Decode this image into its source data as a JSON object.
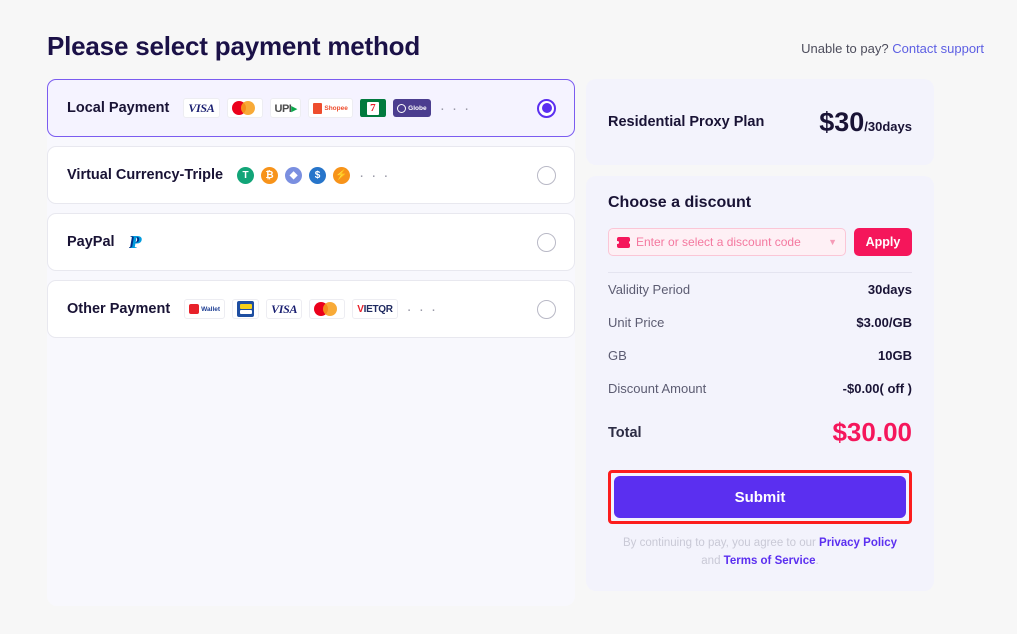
{
  "header": {
    "title": "Please select payment method",
    "support_prefix": "Unable to pay? ",
    "support_link": "Contact support"
  },
  "payment_methods": [
    {
      "name": "Local Payment",
      "selected": true,
      "logos": [
        "visa",
        "mastercard",
        "upi",
        "shopee",
        "seven-eleven",
        "globe"
      ],
      "overflow": "· · ·"
    },
    {
      "name": "Virtual Currency-Triple",
      "selected": false,
      "logos": [
        "tether",
        "bitcoin",
        "ethereum",
        "usdc",
        "lightning"
      ],
      "overflow": "· · ·"
    },
    {
      "name": "PayPal",
      "selected": false,
      "logos": [
        "paypal"
      ],
      "overflow": ""
    },
    {
      "name": "Other Payment",
      "selected": false,
      "logos": [
        "airtel-wallet",
        "touch-n-go",
        "visa",
        "mastercard",
        "vietqr"
      ],
      "overflow": "· · ·"
    }
  ],
  "plan": {
    "name": "Residential Proxy Plan",
    "price_amount": "$30",
    "price_period": "/30days"
  },
  "discount": {
    "title": "Choose a discount",
    "placeholder": "Enter or select a discount code",
    "value": "",
    "apply_label": "Apply"
  },
  "details": [
    {
      "label": "Validity Period",
      "value": "30days"
    },
    {
      "label": "Unit Price",
      "value": "$3.00/GB"
    },
    {
      "label": "GB",
      "value": "10GB"
    },
    {
      "label": "Discount Amount",
      "value": "-$0.00( off )"
    }
  ],
  "total": {
    "label": "Total",
    "value": "$30.00"
  },
  "submit": {
    "label": "Submit",
    "highlighted": true
  },
  "legal": {
    "prefix": "By continuing to pay, you agree to our ",
    "privacy": "Privacy Policy",
    "middle": " and ",
    "terms": "Terms of Service",
    "suffix": "."
  },
  "colors": {
    "accent": "#5b2ff0",
    "pink": "#f5165b",
    "panel_bg": "#f3f3fc",
    "page_bg": "#f7f7f7",
    "highlight": "#fc1d1d"
  }
}
